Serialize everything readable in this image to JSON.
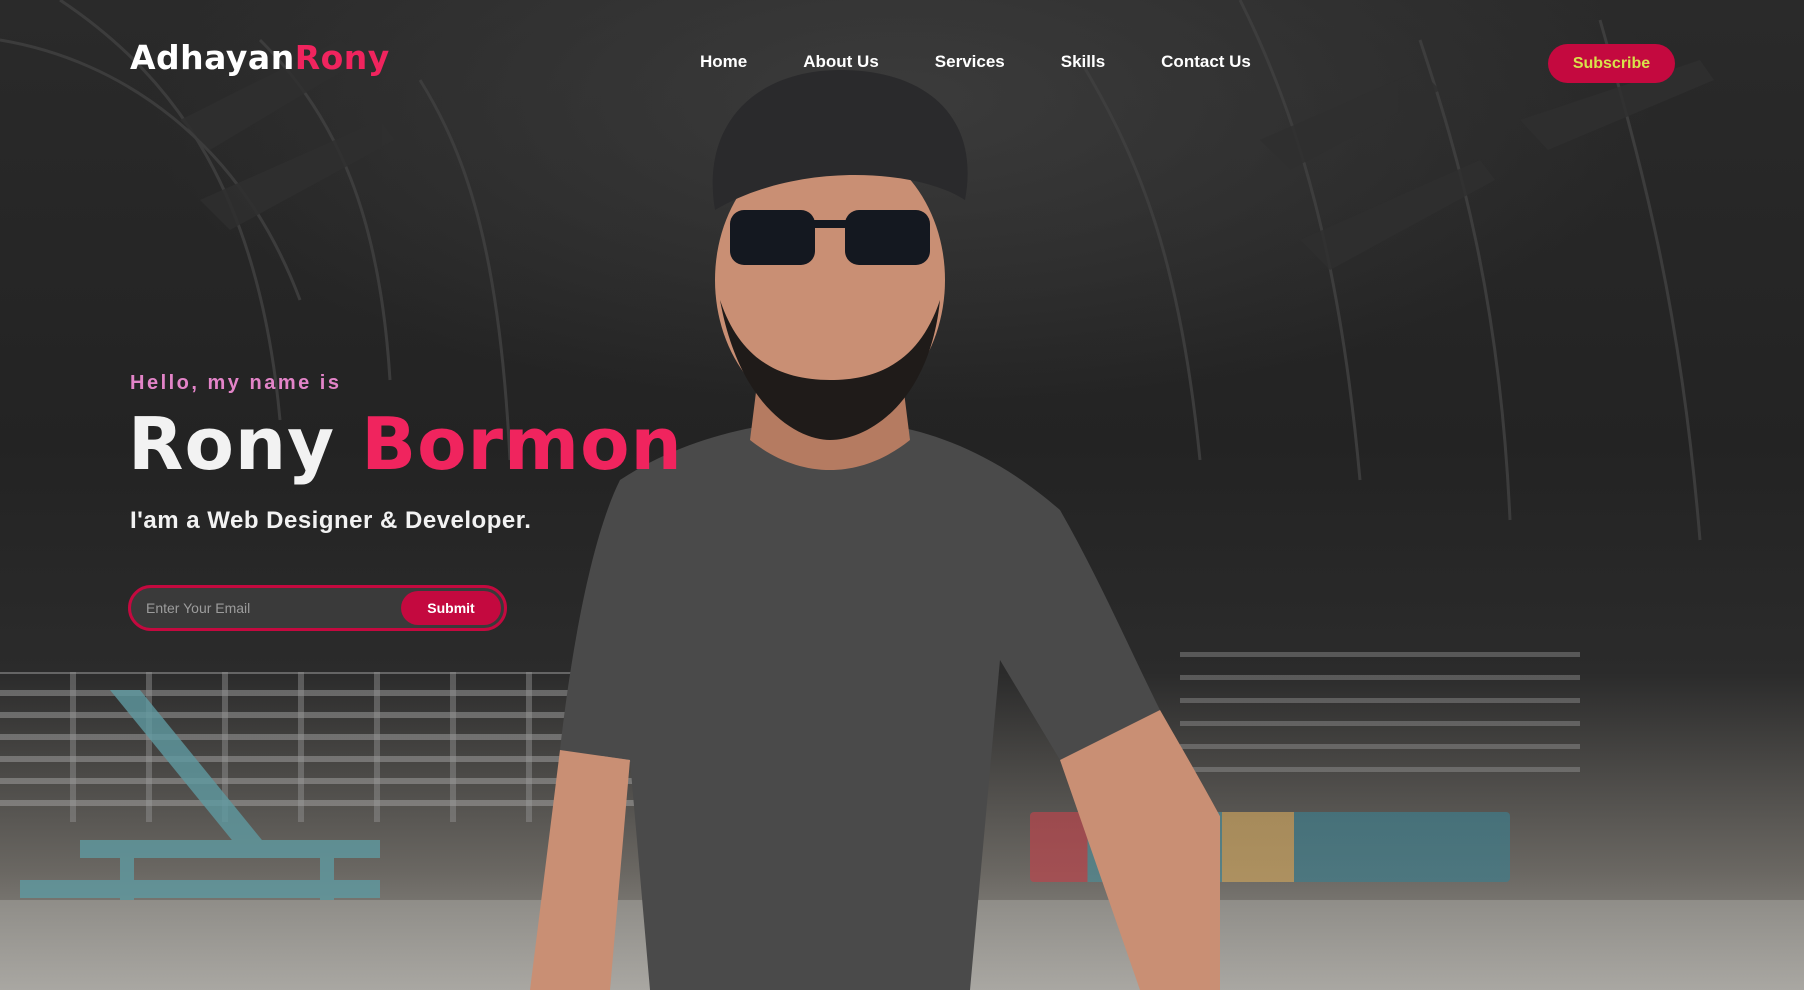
{
  "brand": {
    "name_part1": "Adhayan",
    "name_part2": "Rony",
    "accent_color": "#f0245e"
  },
  "nav": {
    "items": [
      {
        "label": "Home"
      },
      {
        "label": "About Us"
      },
      {
        "label": "Services"
      },
      {
        "label": "Skills"
      },
      {
        "label": "Contact Us"
      }
    ],
    "subscribe_label": "Subscribe"
  },
  "hero": {
    "greeting": "Hello, my name is",
    "first_name": "Rony",
    "last_name": "Bormon",
    "tagline": "I'am a Web Designer & Developer."
  },
  "form": {
    "email_placeholder": "Enter Your Email",
    "email_value": "",
    "submit_label": "Submit"
  },
  "colors": {
    "primary_button": "#c4093f",
    "subscribe_text": "#d8e24b",
    "greeting_text": "#e384c8"
  }
}
